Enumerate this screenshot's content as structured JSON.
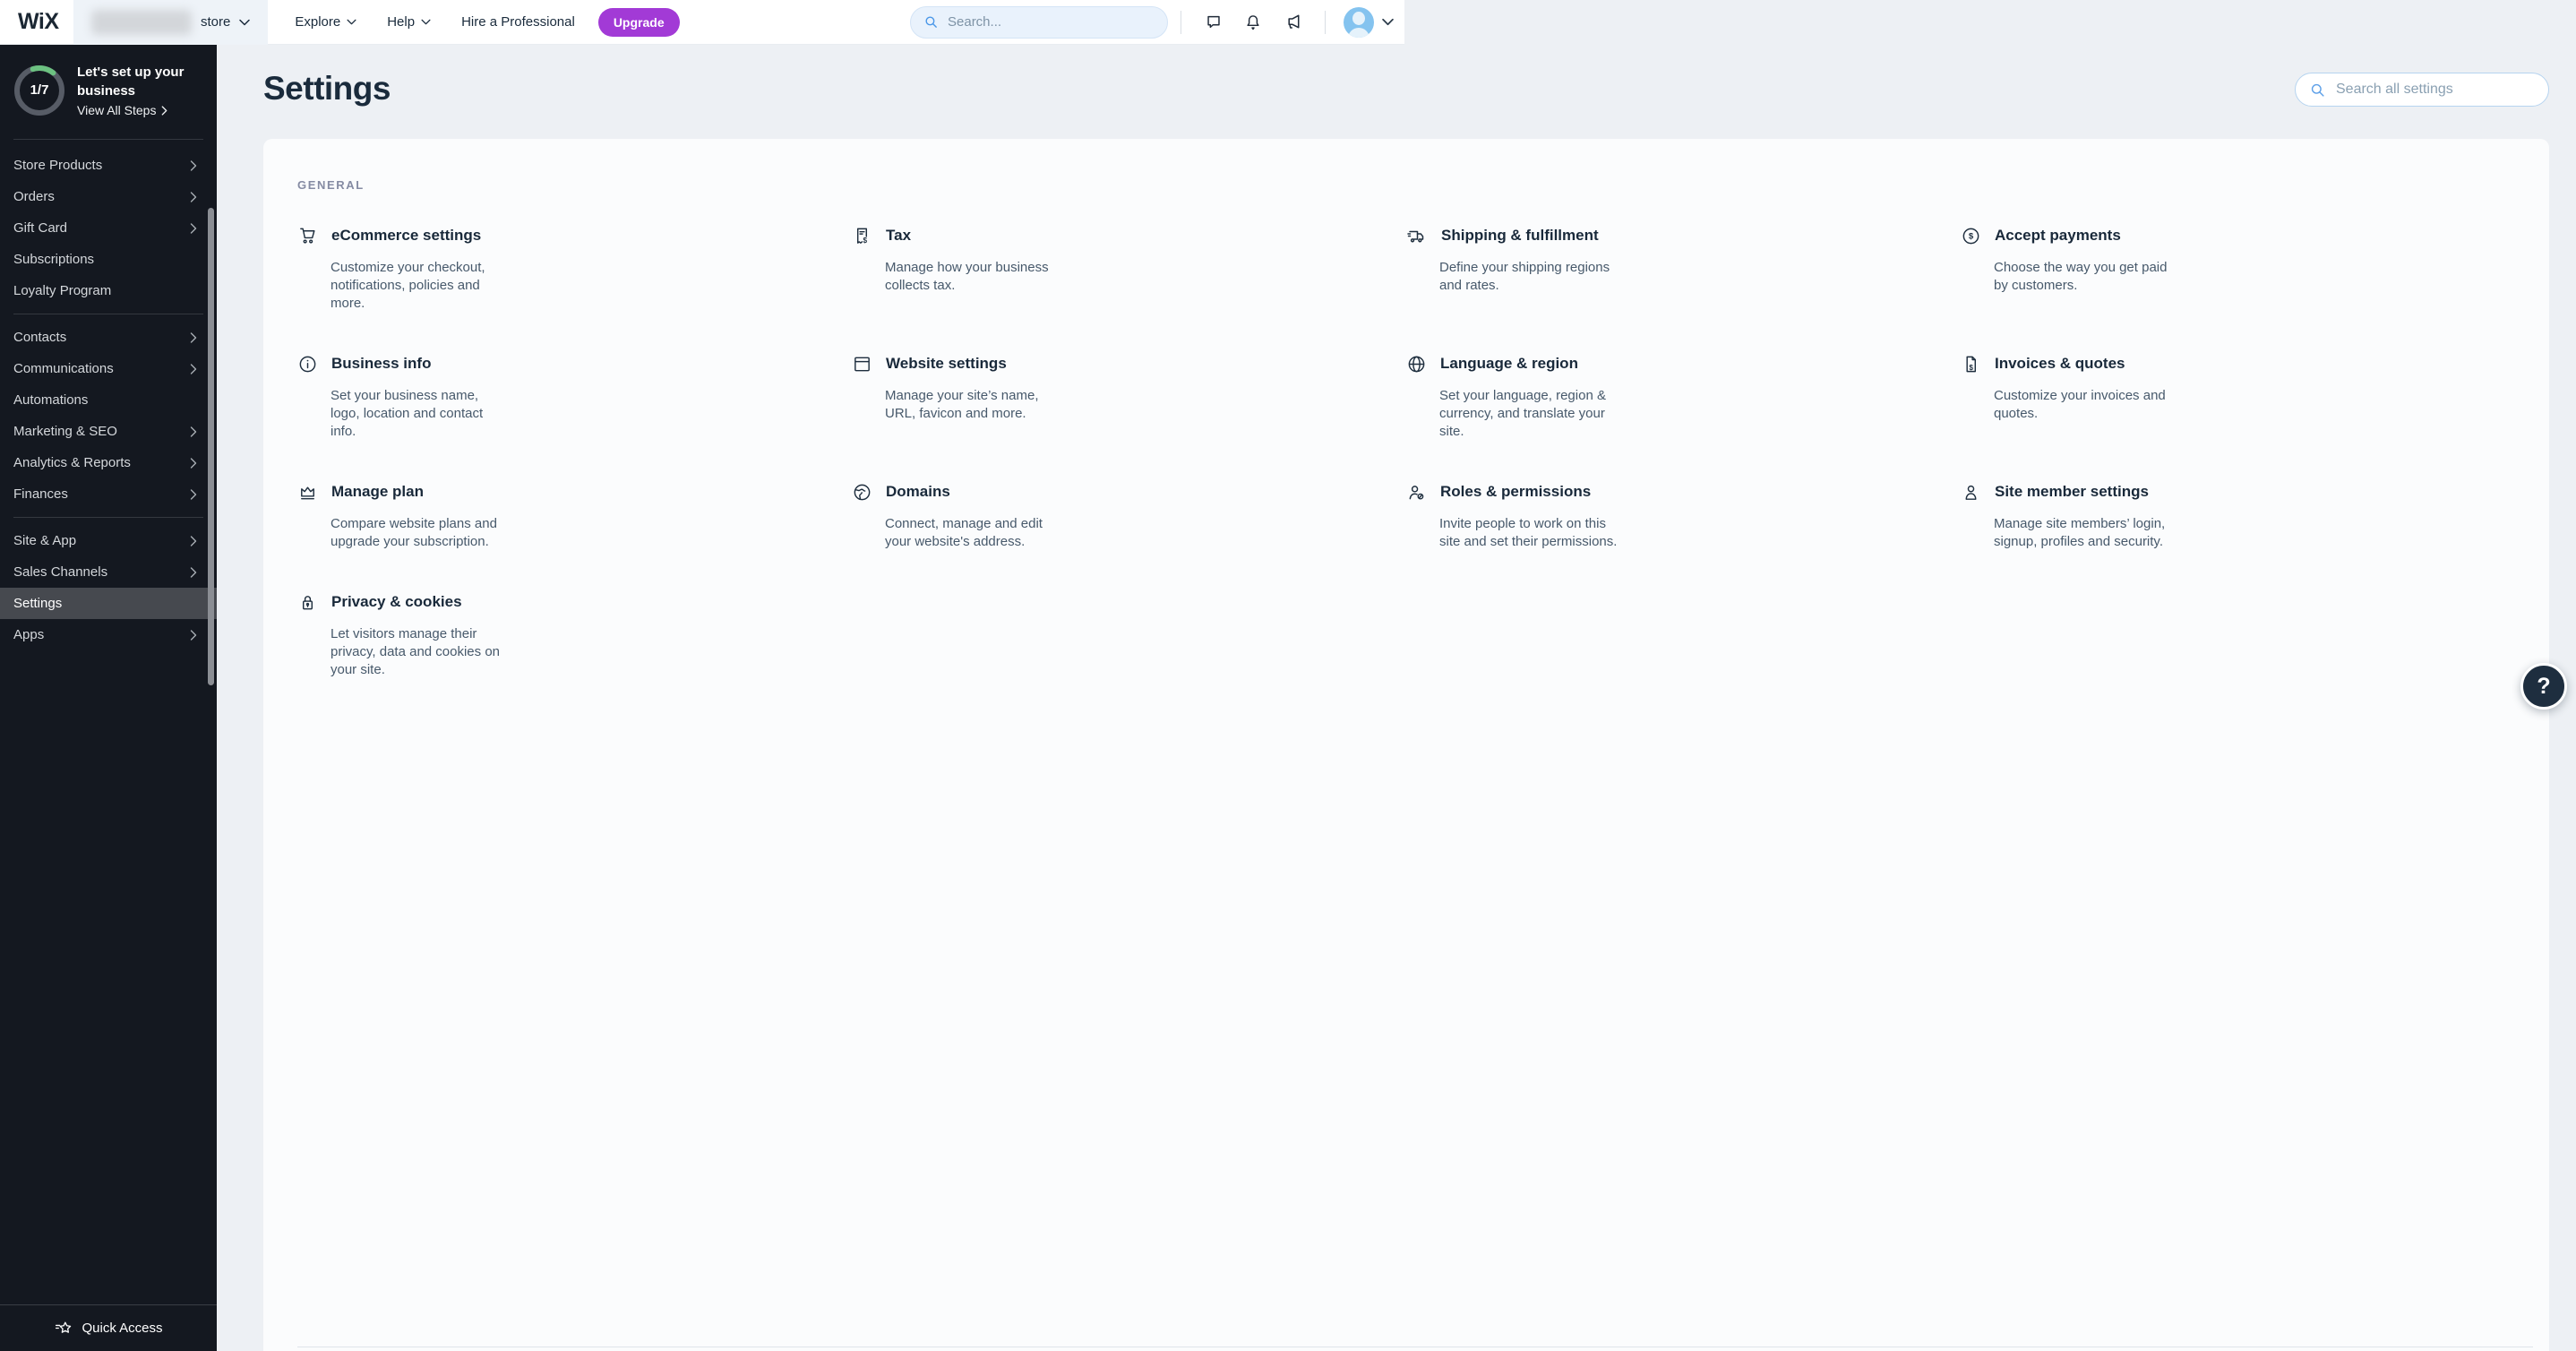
{
  "header": {
    "logo_text": "WiX",
    "site_switcher": {
      "store_label": "store"
    },
    "nav": [
      {
        "label": "Explore"
      },
      {
        "label": "Help"
      },
      {
        "label": "Hire a Professional"
      }
    ],
    "upgrade_label": "Upgrade",
    "search_placeholder": "Search..."
  },
  "sidebar": {
    "setup": {
      "progress": "1/7",
      "title_line1": "Let's set up your",
      "title_line2": "business",
      "link_label": "View All Steps"
    },
    "groups": [
      {
        "items": [
          {
            "label": "Store Products",
            "chevron": true
          },
          {
            "label": "Orders",
            "chevron": true
          },
          {
            "label": "Gift Card",
            "chevron": true
          },
          {
            "label": "Subscriptions",
            "chevron": false
          },
          {
            "label": "Loyalty Program",
            "chevron": false
          }
        ]
      },
      {
        "items": [
          {
            "label": "Contacts",
            "chevron": true
          },
          {
            "label": "Communications",
            "chevron": true
          },
          {
            "label": "Automations",
            "chevron": false
          },
          {
            "label": "Marketing & SEO",
            "chevron": true
          },
          {
            "label": "Analytics & Reports",
            "chevron": true
          },
          {
            "label": "Finances",
            "chevron": true
          }
        ]
      },
      {
        "items": [
          {
            "label": "Site & App",
            "chevron": true
          },
          {
            "label": "Sales Channels",
            "chevron": true
          },
          {
            "label": "Settings",
            "chevron": false,
            "selected": true
          },
          {
            "label": "Apps",
            "chevron": true
          }
        ]
      }
    ],
    "quick_access_label": "Quick Access"
  },
  "main": {
    "title": "Settings",
    "search_placeholder": "Search all settings",
    "section_label": "GENERAL",
    "cards": [
      {
        "title": "eCommerce settings",
        "description": "Customize your checkout, notifications, policies and more.",
        "icon": "cart-icon"
      },
      {
        "title": "Tax",
        "description": "Manage how your business collects tax.",
        "icon": "receipt-icon"
      },
      {
        "title": "Shipping & fulfillment",
        "description": "Define your shipping regions and rates.",
        "icon": "truck-icon"
      },
      {
        "title": "Accept payments",
        "description": "Choose the way you get paid by customers.",
        "icon": "dollar-circle-icon"
      },
      {
        "title": "Business info",
        "description": "Set your business name, logo, location and contact info.",
        "icon": "info-icon"
      },
      {
        "title": "Website settings",
        "description": "Manage your site’s name, URL, favicon and more.",
        "icon": "browser-icon"
      },
      {
        "title": "Language & region",
        "description": "Set your language, region & currency, and translate your site.",
        "icon": "globe-icon"
      },
      {
        "title": "Invoices & quotes",
        "description": "Customize your invoices and quotes.",
        "icon": "invoice-icon"
      },
      {
        "title": "Manage plan",
        "description": "Compare website plans and upgrade your subscription.",
        "icon": "crown-icon"
      },
      {
        "title": "Domains",
        "description": "Connect, manage and edit your website's address.",
        "icon": "world-icon"
      },
      {
        "title": "Roles & permissions",
        "description": "Invite people to work on this site and set their permissions.",
        "icon": "person-role-icon"
      },
      {
        "title": "Site member settings",
        "description": "Manage site members’ login, signup, profiles and security.",
        "icon": "person-icon"
      },
      {
        "title": "Privacy & cookies",
        "description": "Let visitors manage their privacy, data and cookies on your site.",
        "icon": "lock-icon"
      }
    ]
  },
  "help_button": {
    "label": "?"
  },
  "colors": {
    "accent_purple": "#a23ad6",
    "sidebar_bg": "#141820",
    "page_bg": "#edf0f4",
    "ink": "#1a2b3c",
    "progress_green": "#6cc181",
    "avatar_blue": "#84c3ef"
  }
}
